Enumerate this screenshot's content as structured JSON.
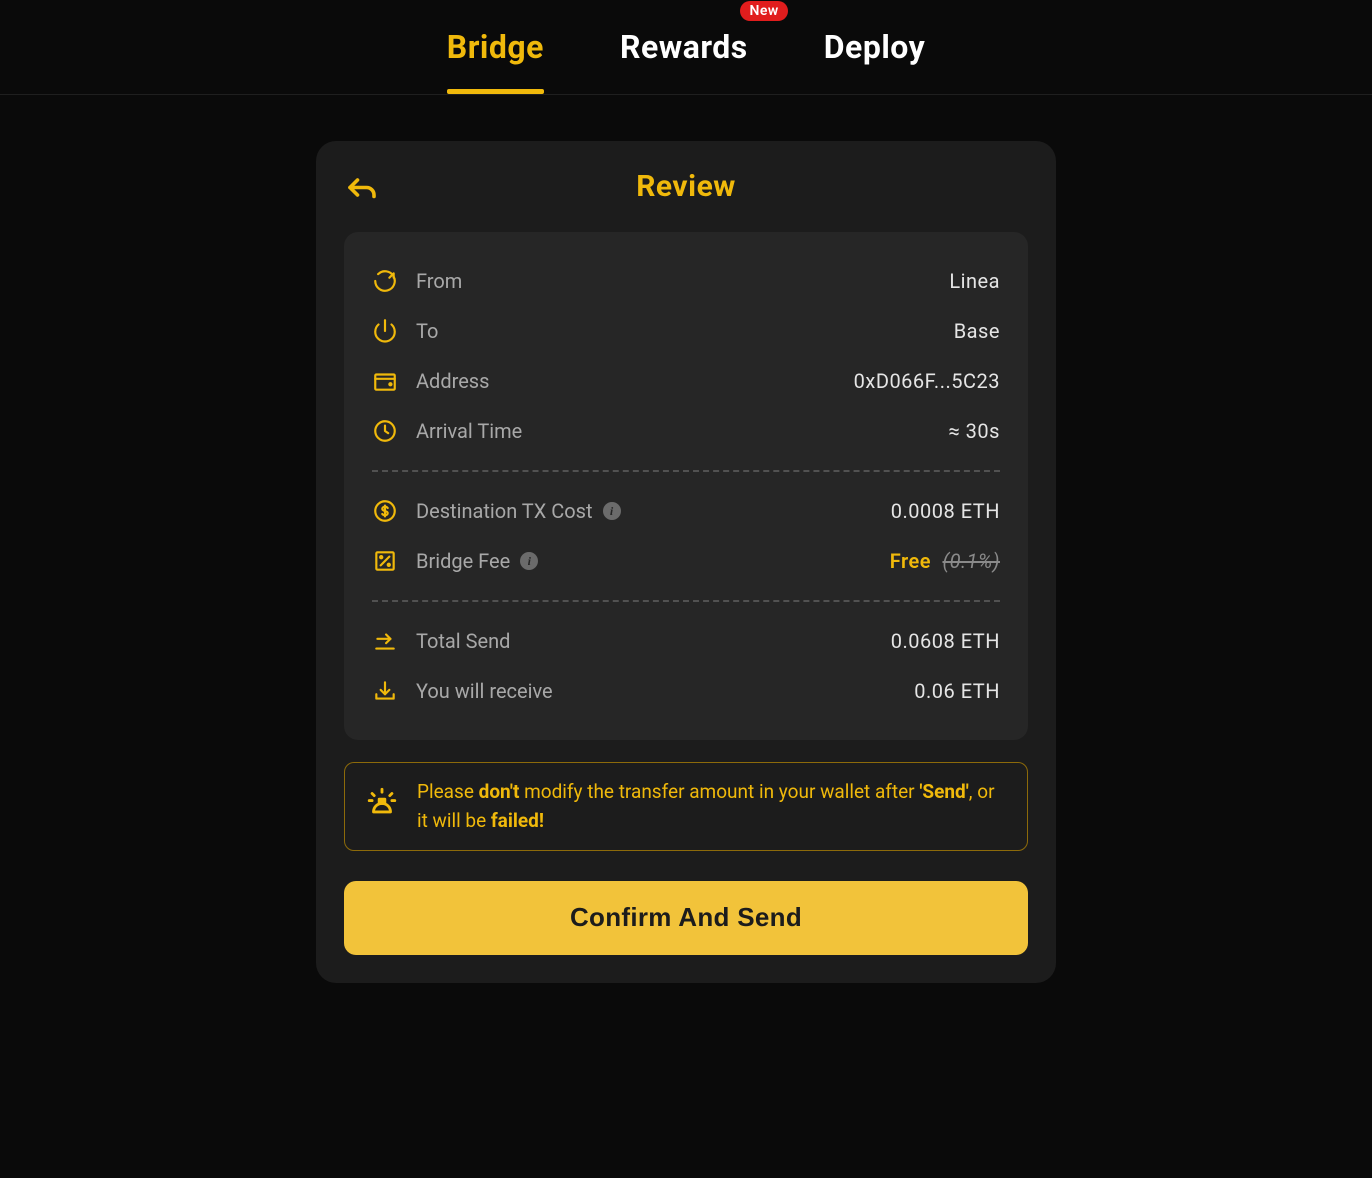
{
  "nav": {
    "bridge": "Bridge",
    "rewards": "Rewards",
    "rewards_badge": "New",
    "deploy": "Deploy"
  },
  "card": {
    "title": "Review",
    "rows": {
      "from_label": "From",
      "from_value": "Linea",
      "to_label": "To",
      "to_value": "Base",
      "address_label": "Address",
      "address_value": "0xD066F...5C23",
      "arrival_label": "Arrival Time",
      "arrival_value": "≈ 30s",
      "txcost_label": "Destination TX Cost",
      "txcost_value": "0.0008 ETH",
      "fee_label": "Bridge Fee",
      "fee_value": "Free",
      "fee_strike": "(0.1%)",
      "totalsend_label": "Total Send",
      "totalsend_value": "0.0608 ETH",
      "receive_label": "You will receive",
      "receive_value": "0.06 ETH"
    },
    "warning": {
      "p1": "Please ",
      "b1": "don't",
      "p2": " modify the transfer amount in your wallet after ",
      "b2": "'Send'",
      "p3": ", or it will be ",
      "b3": "failed!"
    },
    "confirm_label": "Confirm And Send"
  }
}
